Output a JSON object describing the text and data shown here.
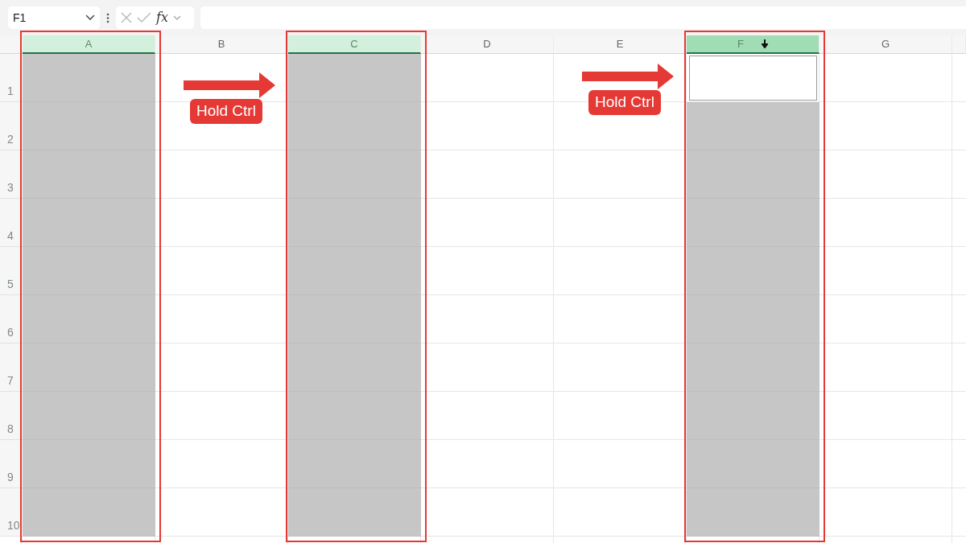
{
  "formula_bar": {
    "name_box": "F1",
    "function_button": "fx"
  },
  "columns": [
    {
      "letter": "A",
      "selected": true,
      "active": false,
      "highlighted": true
    },
    {
      "letter": "B",
      "selected": false,
      "active": false,
      "highlighted": false
    },
    {
      "letter": "C",
      "selected": true,
      "active": false,
      "highlighted": true
    },
    {
      "letter": "D",
      "selected": false,
      "active": false,
      "highlighted": false
    },
    {
      "letter": "E",
      "selected": false,
      "active": false,
      "highlighted": false
    },
    {
      "letter": "F",
      "selected": true,
      "active": true,
      "highlighted": true
    },
    {
      "letter": "G",
      "selected": false,
      "active": false,
      "highlighted": false
    }
  ],
  "rows": [
    "1",
    "2",
    "3",
    "4",
    "5",
    "6",
    "7",
    "8",
    "9",
    "10"
  ],
  "annotations": [
    {
      "label": "Hold Ctrl"
    },
    {
      "label": "Hold Ctrl"
    }
  ]
}
